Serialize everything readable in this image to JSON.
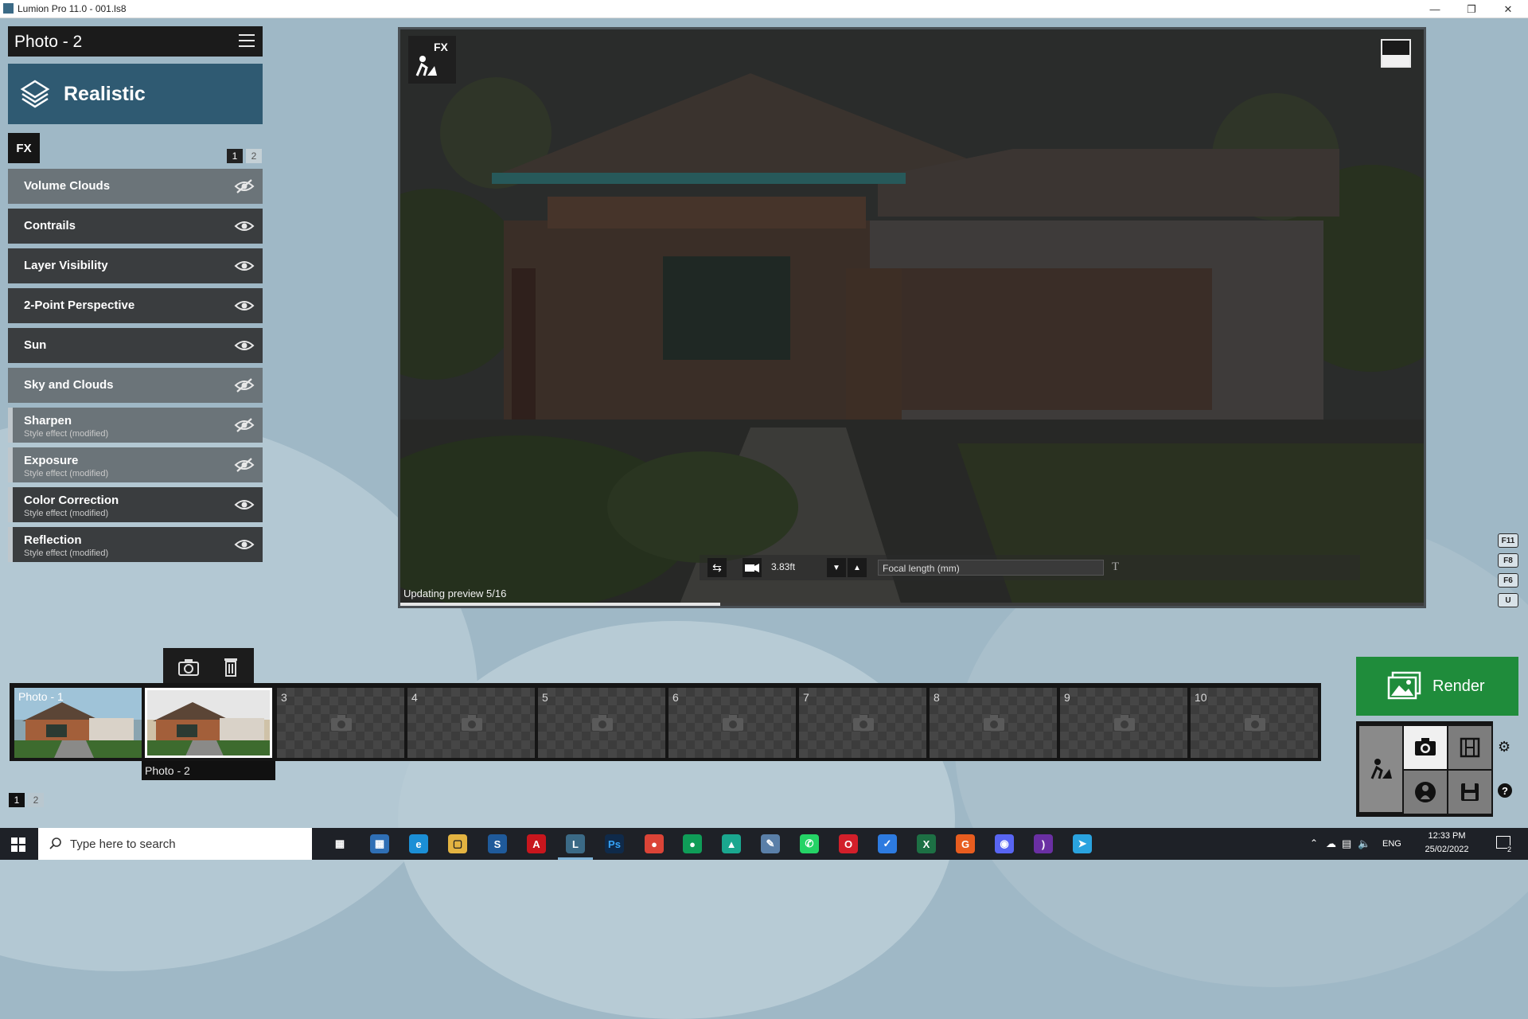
{
  "window": {
    "title": "Lumion Pro 11.0  - 001.ls8",
    "controls": [
      "minimize",
      "restore",
      "close"
    ]
  },
  "left_panel": {
    "photo_title": "Photo - 2",
    "style_name": "Realistic",
    "fx_tab": "FX",
    "pages": [
      "1",
      "2"
    ],
    "effects": [
      {
        "name": "Volume Clouds",
        "subtitle": "",
        "visible": false
      },
      {
        "name": "Contrails",
        "subtitle": "",
        "visible": true
      },
      {
        "name": "Layer Visibility",
        "subtitle": "",
        "visible": true
      },
      {
        "name": "2-Point Perspective",
        "subtitle": "",
        "visible": true
      },
      {
        "name": "Sun",
        "subtitle": "",
        "visible": true
      },
      {
        "name": "Sky and Clouds",
        "subtitle": "",
        "visible": false
      },
      {
        "name": "Sharpen",
        "subtitle": "Style effect (modified)",
        "visible": false
      },
      {
        "name": "Exposure",
        "subtitle": "Style effect (modified)",
        "visible": false
      },
      {
        "name": "Color Correction",
        "subtitle": "Style effect (modified)",
        "visible": true
      },
      {
        "name": "Reflection",
        "subtitle": "Style effect (modified)",
        "visible": true
      }
    ]
  },
  "viewport": {
    "fx_badge": "FX",
    "camera_height": "3.83ft",
    "focal_placeholder": "Focal length (mm)",
    "focal_t": "T",
    "status": "Updating preview 5/16",
    "progress": 0.3125
  },
  "function_keys": [
    "F11",
    "F8",
    "F6",
    "U"
  ],
  "filmstrip": {
    "slots": [
      {
        "label": "Photo - 1",
        "filled": true
      },
      {
        "label": "",
        "filled": true
      },
      {
        "label": "3",
        "filled": false
      },
      {
        "label": "4",
        "filled": false
      },
      {
        "label": "5",
        "filled": false
      },
      {
        "label": "6",
        "filled": false
      },
      {
        "label": "7",
        "filled": false
      },
      {
        "label": "8",
        "filled": false
      },
      {
        "label": "9",
        "filled": false
      },
      {
        "label": "10",
        "filled": false
      }
    ],
    "selected_caption": "Photo - 2",
    "pages": [
      "1",
      "2"
    ]
  },
  "render": {
    "label": "Render"
  },
  "taskbar": {
    "search_placeholder": "Type here to search",
    "lang": "ENG",
    "time": "12:33 PM",
    "date": "25/02/2022",
    "notification_count": "2"
  },
  "colors": {
    "accent_blue": "#2f5a72",
    "render_green": "#1f8c3b",
    "panel_dark": "#3a3d3f"
  }
}
